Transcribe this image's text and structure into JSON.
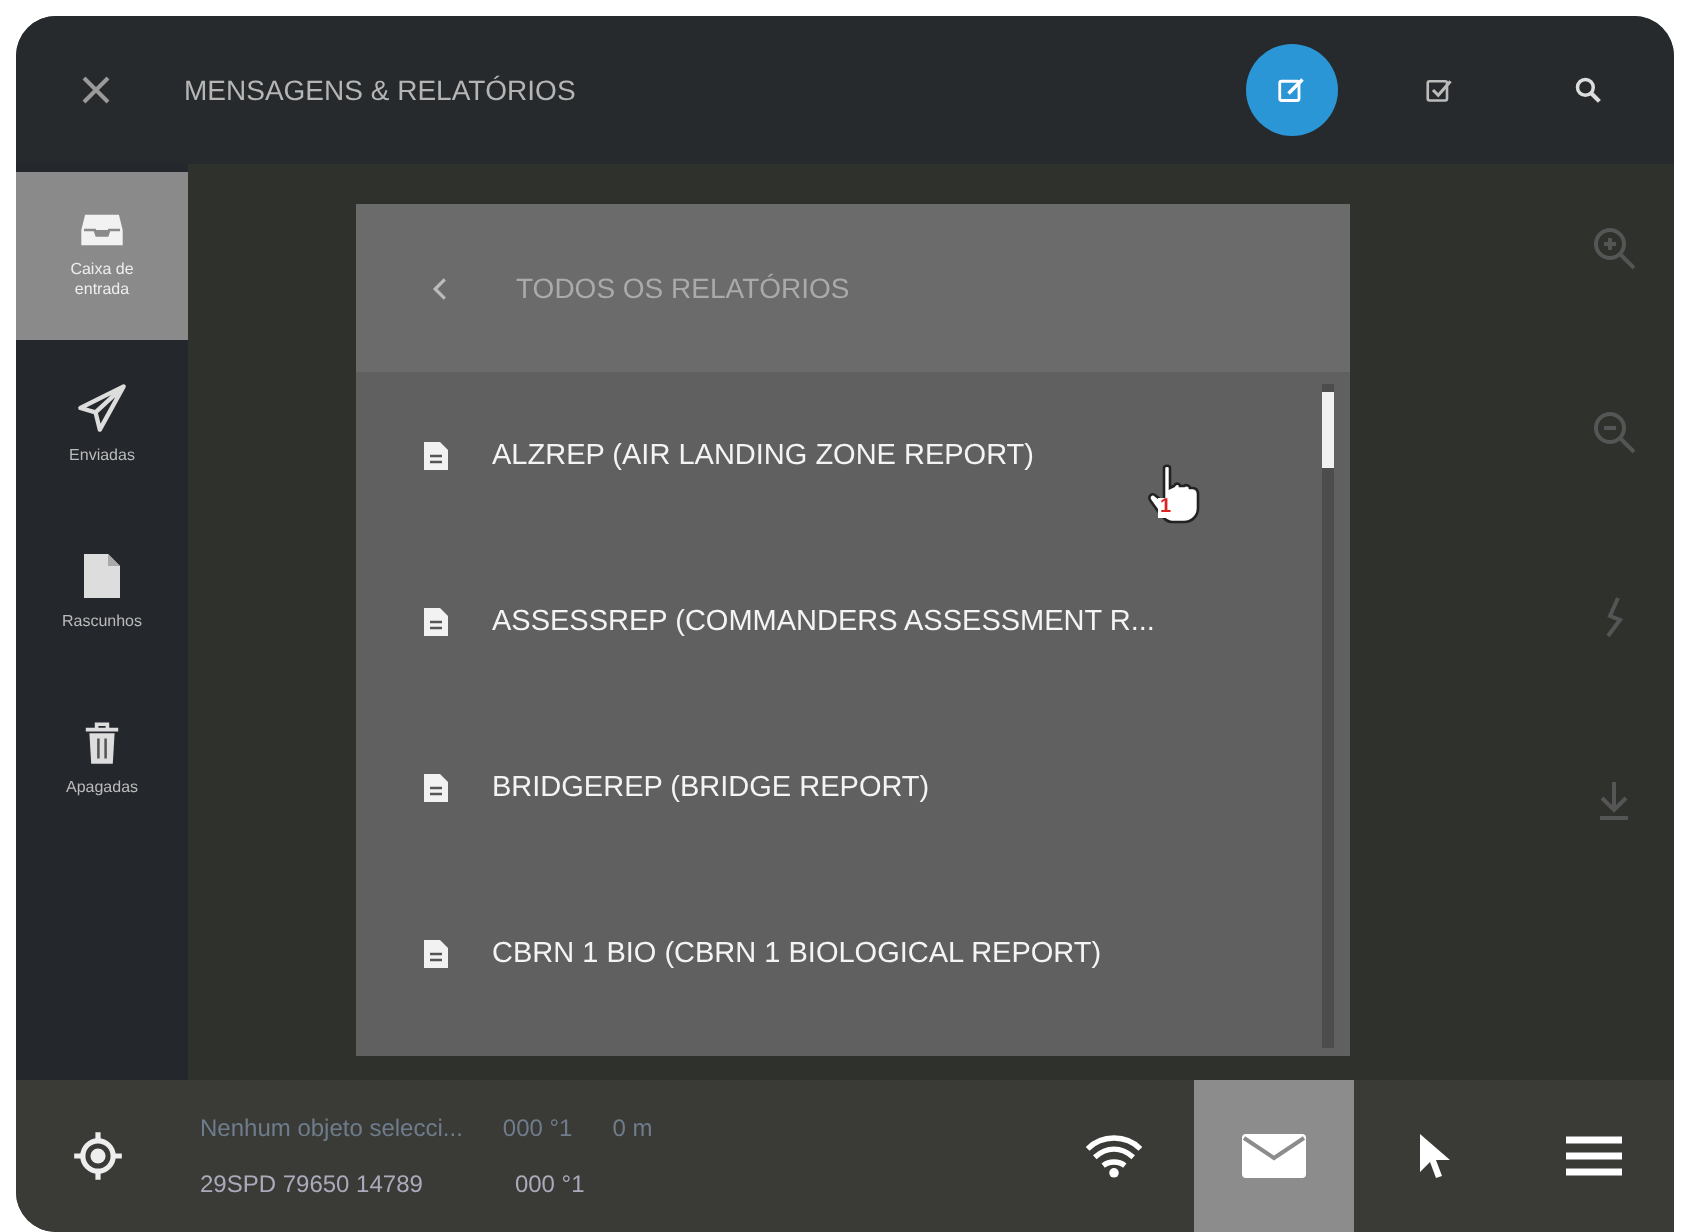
{
  "header": {
    "title": "MENSAGENS & RELATÓRIOS",
    "actions": [
      {
        "kind": "compose",
        "selected": true
      },
      {
        "kind": "checklist",
        "selected": false
      },
      {
        "kind": "search",
        "selected": false
      }
    ]
  },
  "sidebar": {
    "items": [
      {
        "kind": "inbox",
        "label": "Caixa de entrada",
        "selected": true
      },
      {
        "kind": "sent",
        "label": "Enviadas",
        "selected": false
      },
      {
        "kind": "drafts",
        "label": "Rascunhos",
        "selected": false
      },
      {
        "kind": "trash",
        "label": "Apagadas",
        "selected": false
      }
    ]
  },
  "panel": {
    "title": "TODOS OS RELATÓRIOS",
    "items": [
      "ALZREP (AIR LANDING ZONE REPORT)",
      "ASSESSREP (COMMANDERS ASSESSMENT R...",
      "BRIDGEREP (BRIDGE REPORT)",
      "CBRN 1 BIO (CBRN 1 BIOLOGICAL REPORT)"
    ]
  },
  "cursor": {
    "badge": "1"
  },
  "map_controls": [
    {
      "kind": "zoom-in"
    },
    {
      "kind": "zoom-out"
    },
    {
      "kind": "route"
    },
    {
      "kind": "download"
    }
  ],
  "status": {
    "selection": "Nenhum objeto selecci...",
    "bearing": "000 °1",
    "distance": "0 m",
    "grid": "29SPD 79650 14789",
    "azimuth": "000 °1"
  },
  "toolbar": [
    {
      "kind": "wifi",
      "selected": false
    },
    {
      "kind": "mail",
      "selected": true
    },
    {
      "kind": "pointer",
      "selected": false
    },
    {
      "kind": "menu",
      "selected": false
    }
  ]
}
